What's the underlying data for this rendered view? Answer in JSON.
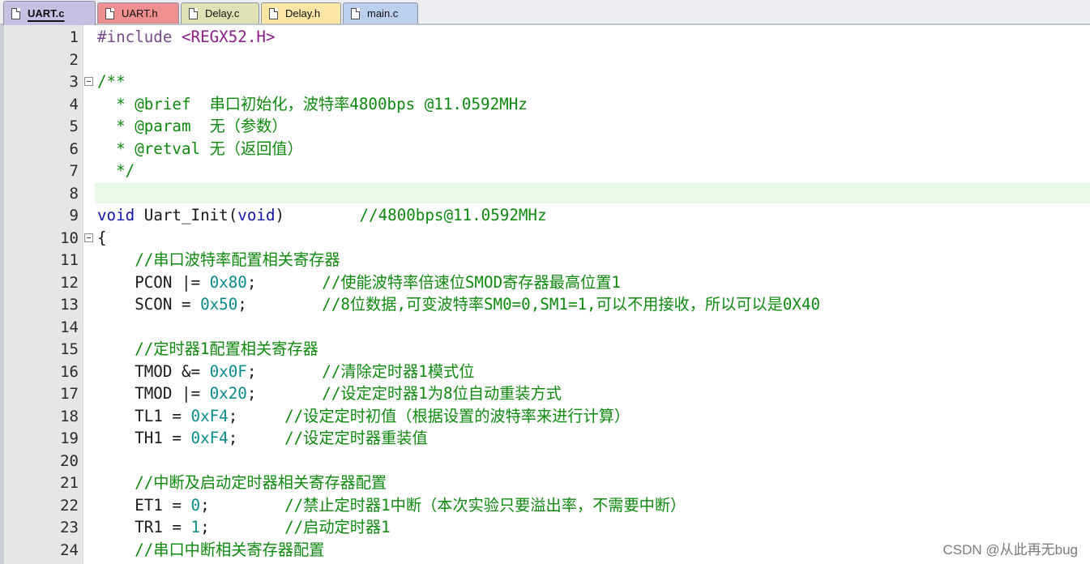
{
  "tabs": [
    {
      "label": "UART.c",
      "color": "#c7c0e2",
      "active": true
    },
    {
      "label": "UART.h",
      "color": "#f08f8f",
      "active": false
    },
    {
      "label": "Delay.c",
      "color": "#dfe1b5",
      "active": false
    },
    {
      "label": "Delay.h",
      "color": "#fbe6a6",
      "active": false
    },
    {
      "label": "main.c",
      "color": "#bcd0ee",
      "active": false
    }
  ],
  "editor": {
    "current_line": 8,
    "lines": [
      {
        "n": "1",
        "fold": false,
        "tokens": [
          {
            "t": "#include ",
            "c": "pp"
          },
          {
            "t": "<REGX52.H>",
            "c": "inc"
          }
        ]
      },
      {
        "n": "2",
        "fold": false,
        "tokens": []
      },
      {
        "n": "3",
        "fold": true,
        "tokens": [
          {
            "t": "/**",
            "c": "cm"
          }
        ]
      },
      {
        "n": "4",
        "fold": false,
        "tokens": [
          {
            "t": "  * @brief  串口初始化，波特率4800bps @11.0592MHz",
            "c": "cm"
          }
        ]
      },
      {
        "n": "5",
        "fold": false,
        "tokens": [
          {
            "t": "  * @param  无（参数）",
            "c": "cm"
          }
        ]
      },
      {
        "n": "6",
        "fold": false,
        "tokens": [
          {
            "t": "  * @retval 无（返回值）",
            "c": "cm"
          }
        ]
      },
      {
        "n": "7",
        "fold": false,
        "tokens": [
          {
            "t": "  */",
            "c": "cm"
          }
        ]
      },
      {
        "n": "8",
        "fold": false,
        "tokens": []
      },
      {
        "n": "9",
        "fold": false,
        "tokens": [
          {
            "t": "void",
            "c": "kw"
          },
          {
            "t": " Uart_Init(",
            "c": ""
          },
          {
            "t": "void",
            "c": "kw"
          },
          {
            "t": ")        ",
            "c": ""
          },
          {
            "t": "//4800bps@11.0592MHz",
            "c": "cm"
          }
        ]
      },
      {
        "n": "10",
        "fold": true,
        "tokens": [
          {
            "t": "{",
            "c": ""
          }
        ]
      },
      {
        "n": "11",
        "fold": false,
        "tokens": [
          {
            "t": "    //串口波特率配置相关寄存器",
            "c": "cm"
          }
        ]
      },
      {
        "n": "12",
        "fold": false,
        "tokens": [
          {
            "t": "    PCON |= ",
            "c": ""
          },
          {
            "t": "0x80",
            "c": "hex"
          },
          {
            "t": ";       ",
            "c": ""
          },
          {
            "t": "//使能波特率倍速位SMOD寄存器最高位置1",
            "c": "cm"
          }
        ]
      },
      {
        "n": "13",
        "fold": false,
        "tokens": [
          {
            "t": "    SCON = ",
            "c": ""
          },
          {
            "t": "0x50",
            "c": "hex"
          },
          {
            "t": ";        ",
            "c": ""
          },
          {
            "t": "//8位数据,可变波特率SM0=0,SM1=1,可以不用接收，所以可以是0X40",
            "c": "cm"
          }
        ]
      },
      {
        "n": "14",
        "fold": false,
        "tokens": []
      },
      {
        "n": "15",
        "fold": false,
        "tokens": [
          {
            "t": "    //定时器1配置相关寄存器",
            "c": "cm"
          }
        ]
      },
      {
        "n": "16",
        "fold": false,
        "tokens": [
          {
            "t": "    TMOD &= ",
            "c": ""
          },
          {
            "t": "0x0F",
            "c": "hex"
          },
          {
            "t": ";       ",
            "c": ""
          },
          {
            "t": "//清除定时器1模式位",
            "c": "cm"
          }
        ]
      },
      {
        "n": "17",
        "fold": false,
        "tokens": [
          {
            "t": "    TMOD |= ",
            "c": ""
          },
          {
            "t": "0x20",
            "c": "hex"
          },
          {
            "t": ";       ",
            "c": ""
          },
          {
            "t": "//设定定时器1为8位自动重装方式",
            "c": "cm"
          }
        ]
      },
      {
        "n": "18",
        "fold": false,
        "tokens": [
          {
            "t": "    TL1 = ",
            "c": ""
          },
          {
            "t": "0xF4",
            "c": "hex"
          },
          {
            "t": ";     ",
            "c": ""
          },
          {
            "t": "//设定定时初值（根据设置的波特率来进行计算）",
            "c": "cm"
          }
        ]
      },
      {
        "n": "19",
        "fold": false,
        "tokens": [
          {
            "t": "    TH1 = ",
            "c": ""
          },
          {
            "t": "0xF4",
            "c": "hex"
          },
          {
            "t": ";     ",
            "c": ""
          },
          {
            "t": "//设定定时器重装值",
            "c": "cm"
          }
        ]
      },
      {
        "n": "20",
        "fold": false,
        "tokens": []
      },
      {
        "n": "21",
        "fold": false,
        "tokens": [
          {
            "t": "    //中断及启动定时器相关寄存器配置",
            "c": "cm"
          }
        ]
      },
      {
        "n": "22",
        "fold": false,
        "tokens": [
          {
            "t": "    ET1 = ",
            "c": ""
          },
          {
            "t": "0",
            "c": "hex"
          },
          {
            "t": ";        ",
            "c": ""
          },
          {
            "t": "//禁止定时器1中断（本次实验只要溢出率，不需要中断）",
            "c": "cm"
          }
        ]
      },
      {
        "n": "23",
        "fold": false,
        "tokens": [
          {
            "t": "    TR1 = ",
            "c": ""
          },
          {
            "t": "1",
            "c": "hex"
          },
          {
            "t": ";        ",
            "c": ""
          },
          {
            "t": "//启动定时器1",
            "c": "cm"
          }
        ]
      },
      {
        "n": "24",
        "fold": false,
        "tokens": [
          {
            "t": "    //串口中断相关寄存器配置",
            "c": "cm"
          }
        ]
      }
    ]
  },
  "watermark": "CSDN @从此再无bug"
}
